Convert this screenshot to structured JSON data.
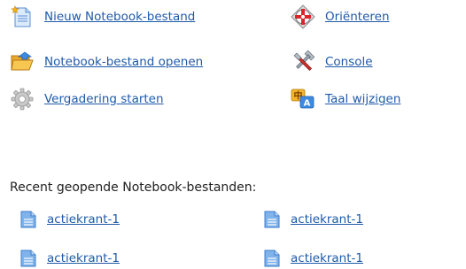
{
  "actions": {
    "new_file": {
      "label": "Nieuw Notebook-bestand",
      "icon": "new-document-icon"
    },
    "open_file": {
      "label": "Notebook-bestand openen",
      "icon": "open-folder-icon"
    },
    "start_meeting": {
      "label": "Vergadering starten",
      "icon": "gear-icon"
    },
    "orient": {
      "label": "Oriënteren",
      "icon": "orient-crosshair-icon"
    },
    "console": {
      "label": "Console",
      "icon": "tools-icon"
    },
    "change_language": {
      "label": "Taal wijzigen",
      "icon": "language-icon"
    }
  },
  "recent": {
    "heading": "Recent geopende Notebook-bestanden:",
    "files": [
      "actiekrant-1",
      "actiekrant-1",
      "actiekrant-1",
      "actiekrant-1"
    ],
    "icon": "notebook-file-icon"
  },
  "colors": {
    "link": "#1f5aa8",
    "text": "#222222",
    "background": "#ffffff"
  }
}
